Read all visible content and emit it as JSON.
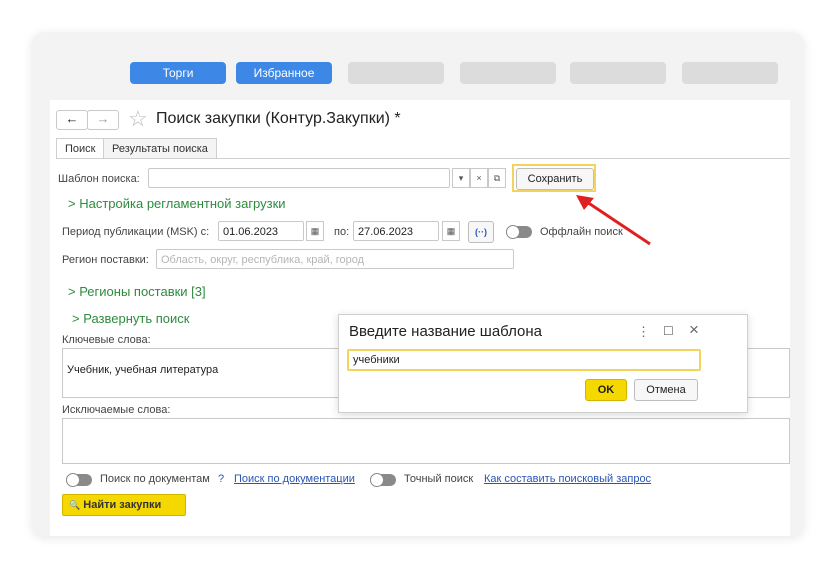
{
  "top_tabs": [
    "Торги",
    "Избранное",
    "",
    "",
    "",
    ""
  ],
  "window": {
    "back_icon": "←",
    "forward_icon": "→",
    "star_icon": "☆",
    "title": "Поиск закупки (Контур.Закупки) *"
  },
  "form_tabs": [
    "Поиск",
    "Результаты поиска"
  ],
  "template": {
    "label": "Шаблон поиска:",
    "value": "",
    "dropdown_icon": "▾",
    "clear_icon": "×",
    "open_icon": "⧉",
    "save_button": "Сохранить"
  },
  "sections": {
    "schedule": "> Настройка регламентной загрузки",
    "regions": "> Регионы поставки [3]",
    "expand": "> Развернуть поиск"
  },
  "period": {
    "label": "Период публикации (MSK) с:",
    "from": "01.06.2023",
    "to_label": "по:",
    "to": "27.06.2023",
    "calendar_icon": "▦",
    "period_button": "(··)",
    "offline_label": "Оффлайн поиск"
  },
  "region": {
    "label": "Регион поставки:",
    "placeholder": "Область, округ, республика, край, город"
  },
  "keywords": {
    "label": "Ключевые слова:",
    "value": "Учебник, учебная литература"
  },
  "excluded": {
    "label": "Исключаемые слова:",
    "value": ""
  },
  "bottom": {
    "doc_search_label": "Поиск по документам",
    "help": "?",
    "doc_search_link": "Поиск по документации",
    "exact_label": "Точный поиск",
    "how_to_link": "Как составить поисковый запрос",
    "find_icon": "🔍",
    "find_button": "Найти закупки"
  },
  "dialog": {
    "title": "Введите название шаблона",
    "menu_icon": "⋮",
    "maximize_icon": "☐",
    "close_icon": "×",
    "input_value": "учебники",
    "ok": "OK",
    "cancel": "Отмена"
  },
  "colors": {
    "accent_blue": "#3d87e6",
    "link_green": "#2e8b3d",
    "ok_yellow": "#f5d800",
    "arrow_red": "#e02020",
    "highlight": "#f2d35c"
  }
}
